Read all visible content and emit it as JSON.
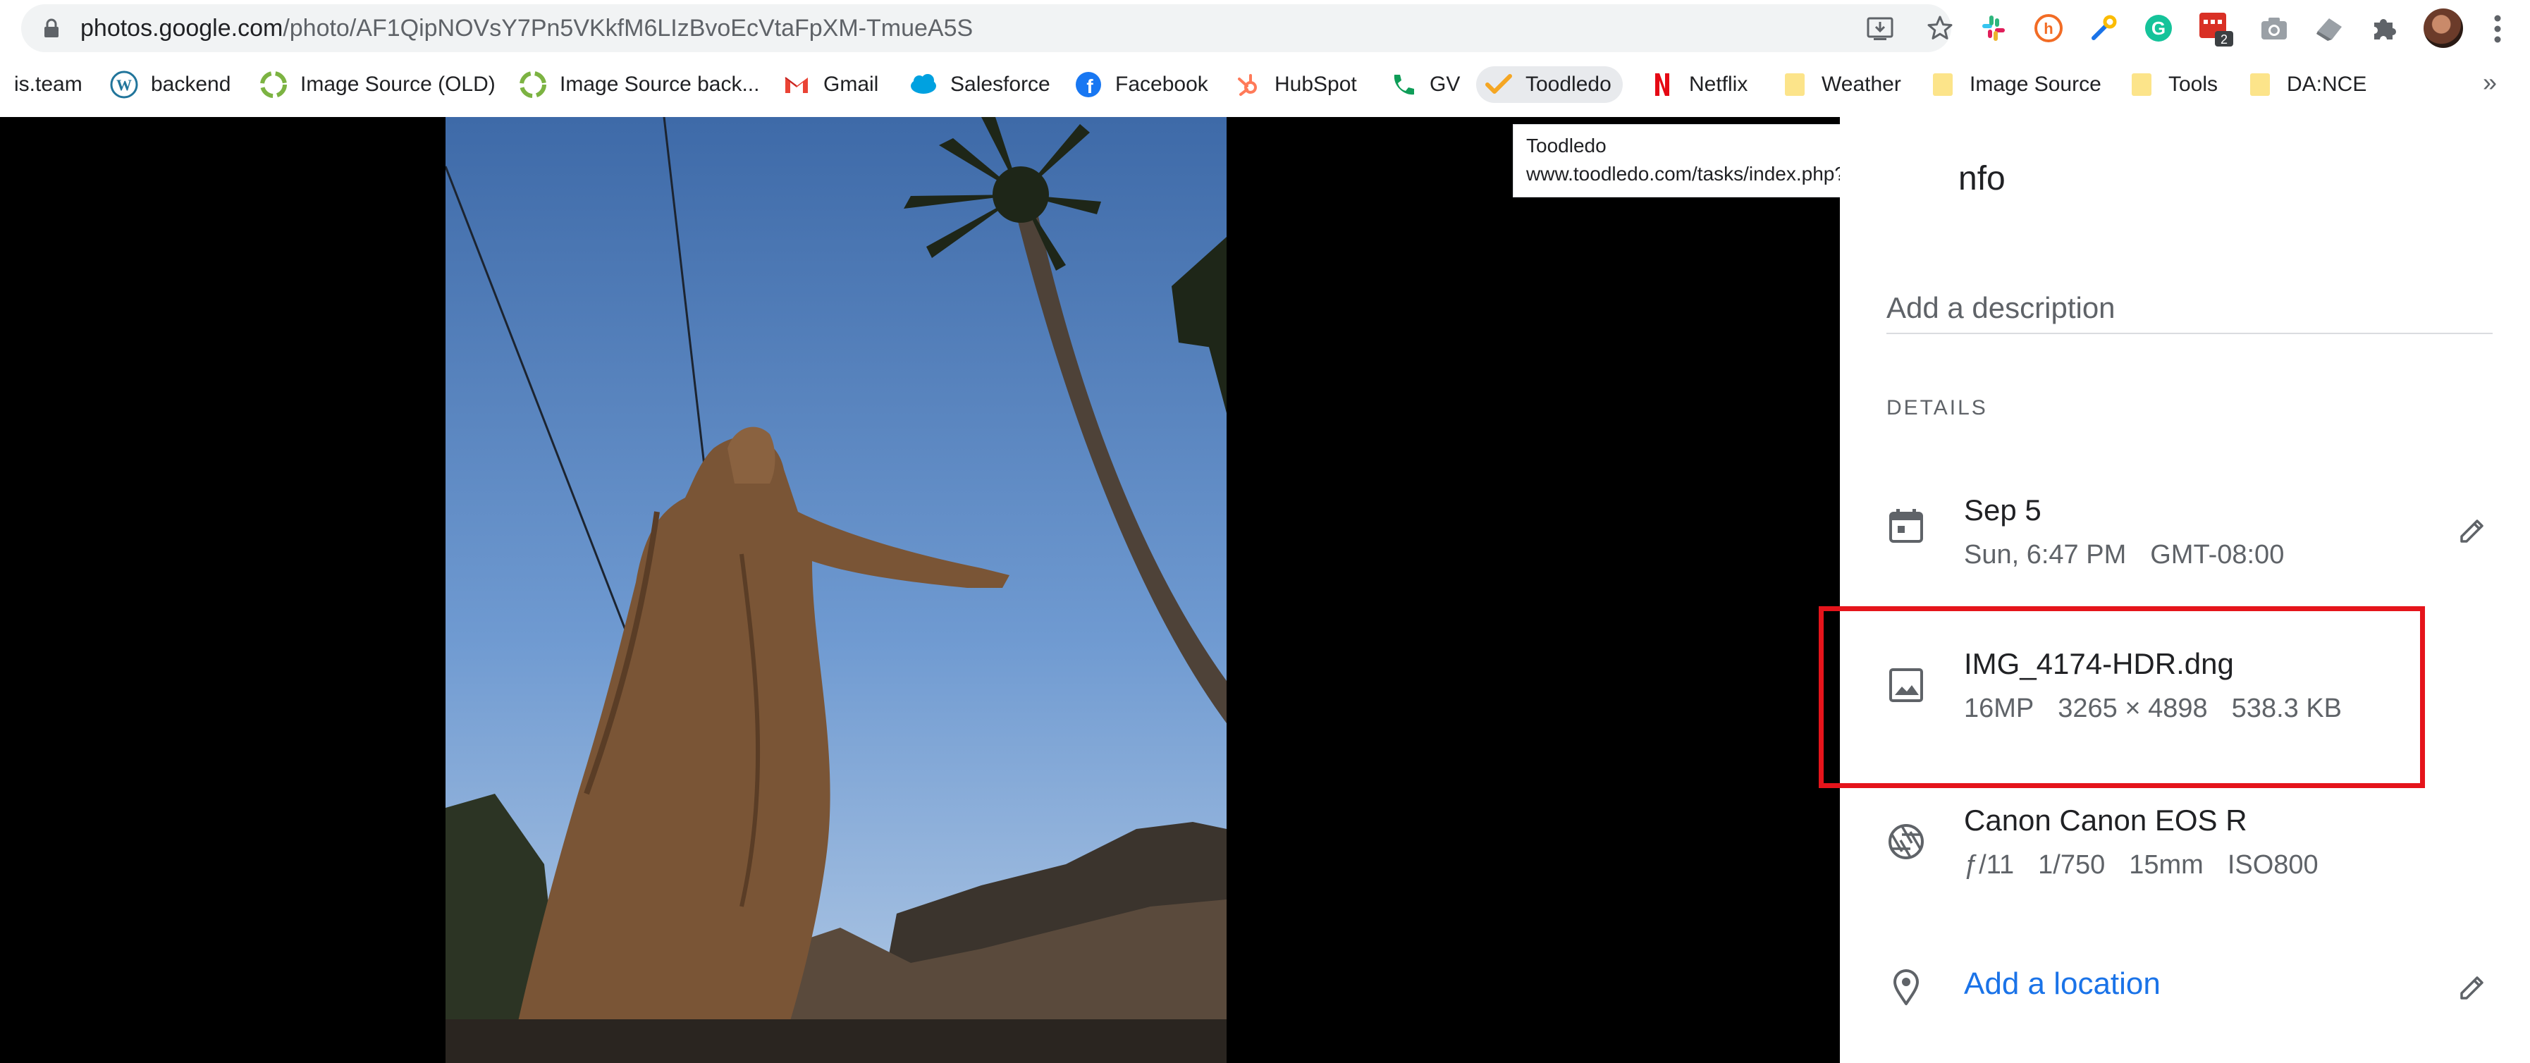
{
  "browser": {
    "url_host": "photos.google.com",
    "url_path": "/photo/AF1QipNOVsY7Pn5VKkfM6LIzBvoEcVtaFpXM-TmueA5S",
    "extensions_badge": "2"
  },
  "bookmarks": [
    {
      "label": "is.team",
      "icon": "none"
    },
    {
      "label": "backend",
      "icon": "wordpress-icon"
    },
    {
      "label": "Image Source (OLD)",
      "icon": "image-source-icon"
    },
    {
      "label": "Image Source back...",
      "icon": "image-source-icon"
    },
    {
      "label": "Gmail",
      "icon": "gmail-icon"
    },
    {
      "label": "Salesforce",
      "icon": "salesforce-icon"
    },
    {
      "label": "Facebook",
      "icon": "facebook-icon"
    },
    {
      "label": "HubSpot",
      "icon": "hubspot-icon"
    },
    {
      "label": "GV",
      "icon": "google-voice-icon"
    },
    {
      "label": "Toodledo",
      "icon": "toodledo-check-icon"
    },
    {
      "label": "Netflix",
      "icon": "netflix-icon"
    },
    {
      "label": "Weather",
      "icon": "folder-icon"
    },
    {
      "label": "Image Source",
      "icon": "folder-icon"
    },
    {
      "label": "Tools",
      "icon": "folder-icon"
    },
    {
      "label": "DA:NCE",
      "icon": "folder-icon"
    }
  ],
  "bookmarks_more": "»",
  "tooltip": {
    "title": "Toodledo",
    "url": "www.toodledo.com/tasks/index.php?#context"
  },
  "info_panel": {
    "title": "nfo",
    "description_placeholder": "Add a description",
    "details_label": "DETAILS",
    "date": {
      "main": "Sep 5",
      "day_time": "Sun, 6:47 PM",
      "timezone": "GMT-08:00"
    },
    "file": {
      "name": "IMG_4174-HDR.dng",
      "megapixels": "16MP",
      "dimensions": "3265 × 4898",
      "size": "538.3 KB"
    },
    "camera": {
      "model": "Canon Canon EOS R",
      "aperture": "ƒ/11",
      "shutter": "1/750",
      "focal_length": "15mm",
      "iso": "ISO800"
    },
    "location_label": "Add a location"
  },
  "colors": {
    "highlight": "#e5141b",
    "link": "#1a73e8",
    "viewer_bg": "#000000"
  }
}
